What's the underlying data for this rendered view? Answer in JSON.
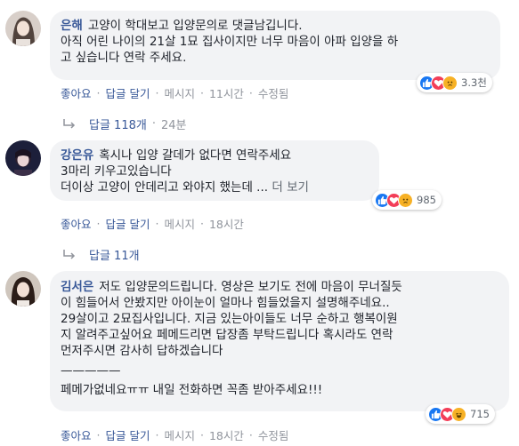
{
  "comments": [
    {
      "author": "은해",
      "lines": [
        "고양이 학대보고 입양문의로 댓글남깁니다.",
        "아직 어린 나이의 21살 1묘 집사이지만 너무 마음이 아파 입양을 하",
        "고 싶습니다 연락 주세요."
      ],
      "reaction_count": "3.3천",
      "actions": {
        "like": "좋아요",
        "reply": "답글 달기",
        "message": "메시지",
        "time": "11시간",
        "edited": "수정됨"
      },
      "replies": {
        "label": "답글 118개",
        "time": "24분"
      }
    },
    {
      "author": "강은유",
      "lines": [
        "혹시나 입양 갈데가 없다면 연락주세요",
        "3마리 키우고있습니다",
        "더이상 고양이 안데리고 와야지 했는데 ..."
      ],
      "see_more": "더 보기",
      "reaction_count": "985",
      "actions": {
        "like": "좋아요",
        "reply": "답글 달기",
        "message": "메시지",
        "time": "18시간"
      },
      "replies": {
        "label": "답글 11개"
      }
    },
    {
      "author": "김서은",
      "lines": [
        "저도 입양문의드립니다. 영상은 보기도 전에 마음이 무너질듯",
        "이 힘들어서 안봤지만 아이눈이 얼마나 힘들었을지 설명해주네요..",
        "29살이고 2묘집사입니다. 지금 있는아이들도 너무 순하고 행복이원",
        "지 알려주고싶어요 페메드리면 답장좀 부탁드립니다 혹시라도 연락",
        "먼저주시면 감사히 답하겠습니다",
        "—————",
        "페메가없네요ㅠㅠ 내일 전화하면 꼭좀 받아주세요!!!"
      ],
      "reaction_count": "715",
      "actions": {
        "like": "좋아요",
        "reply": "답글 달기",
        "message": "메시지",
        "time": "18시간",
        "edited": "수정됨"
      }
    }
  ],
  "colors": {
    "name": "#385898",
    "meta": "#90949c",
    "bubble": "#f2f3f5",
    "like": "#1877f2",
    "love": "#f33e58",
    "haha": "#f7b125"
  },
  "icons": [
    "like-reaction-icon",
    "love-reaction-icon",
    "sad-reaction-icon",
    "haha-reaction-icon",
    "reply-arrow-icon"
  ]
}
